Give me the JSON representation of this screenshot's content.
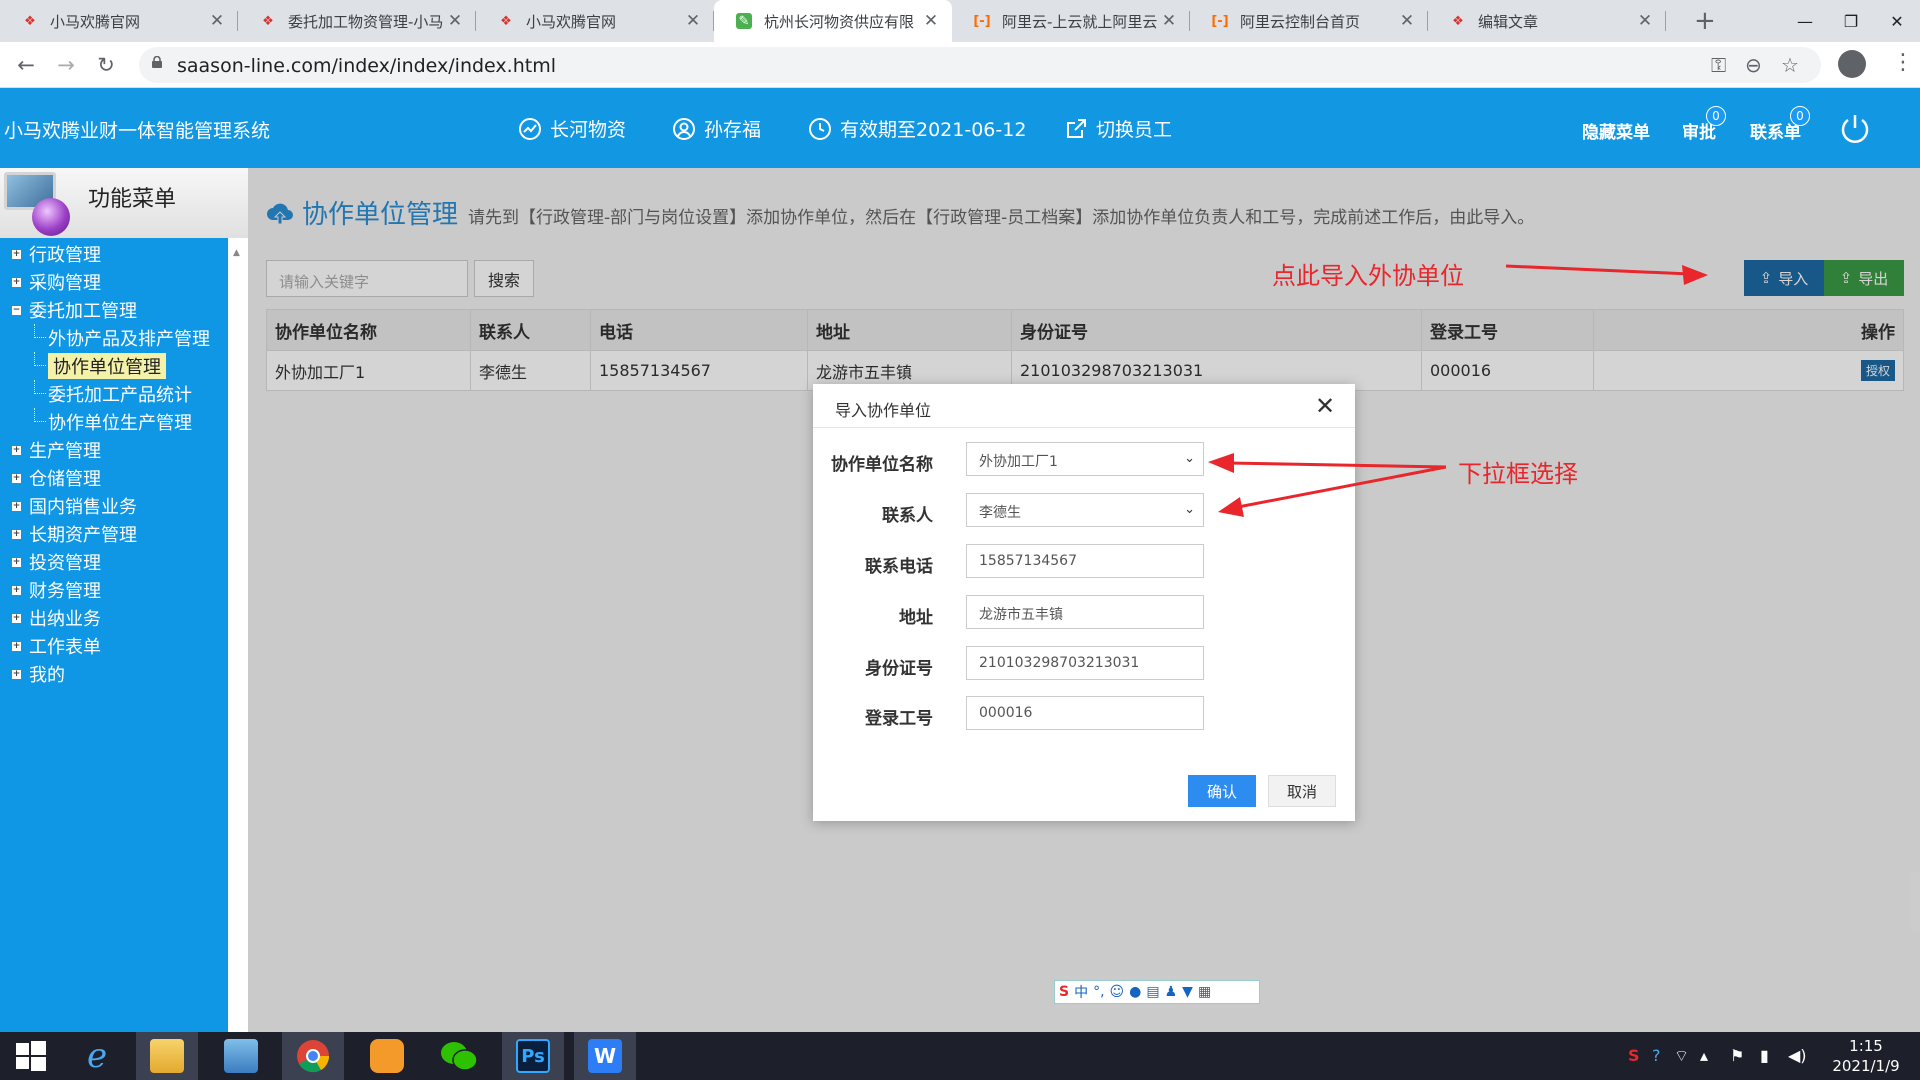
{
  "browser": {
    "tabs": [
      {
        "title": "小马欢腾官网",
        "active": false,
        "icon": "hx-logo-icon"
      },
      {
        "title": "委托加工物资管理-小马",
        "active": false,
        "icon": "hx-logo-icon"
      },
      {
        "title": "小马欢腾官网",
        "active": false,
        "icon": "hx-logo-icon"
      },
      {
        "title": "杭州长河物资供应有限",
        "active": true,
        "icon": "leaf-icon"
      },
      {
        "title": "阿里云-上云就上阿里云",
        "active": false,
        "icon": "aliyun-icon"
      },
      {
        "title": "阿里云控制台首页",
        "active": false,
        "icon": "aliyun-icon"
      },
      {
        "title": "编辑文章",
        "active": false,
        "icon": "hx-logo-icon"
      }
    ],
    "url": "saason-line.com/index/index/index.html"
  },
  "header": {
    "app_title": "小马欢腾业财一体智能管理系统",
    "company": "长河物资",
    "user": "孙存福",
    "validity": "有效期至2021-06-12",
    "switch_staff": "切换员工",
    "hide_menu": "隐藏菜单",
    "approval": "审批",
    "approval_count": "0",
    "contact": "联系单",
    "contact_count": "0"
  },
  "sidebar": {
    "title": "功能菜单",
    "items": [
      {
        "label": "行政管理",
        "expanded": false
      },
      {
        "label": "采购管理",
        "expanded": false
      },
      {
        "label": "委托加工管理",
        "expanded": true
      },
      {
        "label": "生产管理",
        "expanded": false
      },
      {
        "label": "仓储管理",
        "expanded": false
      },
      {
        "label": "国内销售业务",
        "expanded": false
      },
      {
        "label": "长期资产管理",
        "expanded": false
      },
      {
        "label": "投资管理",
        "expanded": false
      },
      {
        "label": "财务管理",
        "expanded": false
      },
      {
        "label": "出纳业务",
        "expanded": false
      },
      {
        "label": "工作表单",
        "expanded": false
      },
      {
        "label": "我的",
        "expanded": false
      }
    ],
    "children": [
      {
        "label": "外协产品及排产管理",
        "selected": false
      },
      {
        "label": "协作单位管理",
        "selected": true
      },
      {
        "label": "委托加工产品统计",
        "selected": false
      },
      {
        "label": "协作单位生产管理",
        "selected": false
      }
    ]
  },
  "page": {
    "title": "协作单位管理",
    "description": "请先到【行政管理-部门与岗位设置】添加协作单位，然后在【行政管理-员工档案】添加协作单位负责人和工号，完成前述工作后，由此导入。",
    "search_placeholder": "请输入关键字",
    "search_button": "搜索",
    "import_button": "导入",
    "export_button": "导出"
  },
  "table": {
    "columns": [
      "协作单位名称",
      "联系人",
      "电话",
      "地址",
      "身份证号",
      "登录工号",
      "操作"
    ],
    "rows": [
      {
        "name": "外协加工厂1",
        "contact": "李德生",
        "phone": "15857134567",
        "address": "龙游市五丰镇",
        "id_number": "210103298703213031",
        "login_id": "000016",
        "action": "授权"
      }
    ]
  },
  "modal": {
    "title": "导入协作单位",
    "fields": [
      {
        "label": "协作单位名称",
        "value": "外协加工厂1",
        "type": "select"
      },
      {
        "label": "联系人",
        "value": "李德生",
        "type": "select"
      },
      {
        "label": "联系电话",
        "value": "15857134567",
        "type": "text"
      },
      {
        "label": "地址",
        "value": "龙游市五丰镇",
        "type": "text"
      },
      {
        "label": "身份证号",
        "value": "210103298703213031",
        "type": "text"
      },
      {
        "label": "登录工号",
        "value": "000016",
        "type": "text"
      }
    ],
    "confirm": "确认",
    "cancel": "取消"
  },
  "annotations": {
    "import_hint": "点此导入外协单位",
    "dropdown_hint": "下拉框选择"
  },
  "ime": {
    "label": "中"
  },
  "taskbar": {
    "time": "1:15",
    "date": "2021/1/9"
  },
  "colors": {
    "header_blue": "#1297e3",
    "sidebar_blue": "#0f96e4",
    "import_blue": "#1d6aa5",
    "export_green": "#3c9a45",
    "annotation_red": "#e8262b",
    "confirm_blue": "#2d8cf0"
  }
}
